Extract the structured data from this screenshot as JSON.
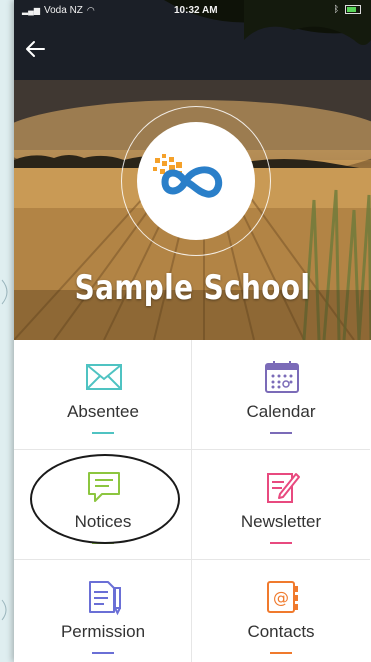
{
  "status_bar": {
    "carrier": "Voda NZ",
    "time": "10:32 AM",
    "battery": "battery-icon"
  },
  "header": {
    "back_icon": "arrow-left-icon",
    "school_name": "Sample School"
  },
  "menu": [
    {
      "id": "absentee",
      "label": "Absentee",
      "icon": "envelope-icon",
      "accent": "#4fc3c2"
    },
    {
      "id": "calendar",
      "label": "Calendar",
      "icon": "calendar-icon",
      "accent": "#7b6bb8"
    },
    {
      "id": "notices",
      "label": "Notices",
      "icon": "speech-bubble-icon",
      "accent": "#8cc63f"
    },
    {
      "id": "newsletter",
      "label": "Newsletter",
      "icon": "pencil-note-icon",
      "accent": "#e84a7f"
    },
    {
      "id": "permission",
      "label": "Permission",
      "icon": "document-pen-icon",
      "accent": "#6a6fd6"
    },
    {
      "id": "contacts",
      "label": "Contacts",
      "icon": "address-book-icon",
      "accent": "#f07a2d"
    }
  ],
  "colors": {
    "background": "#dfeef0",
    "logo_blue": "#2a7fc9",
    "logo_orange": "#f5a12a"
  }
}
